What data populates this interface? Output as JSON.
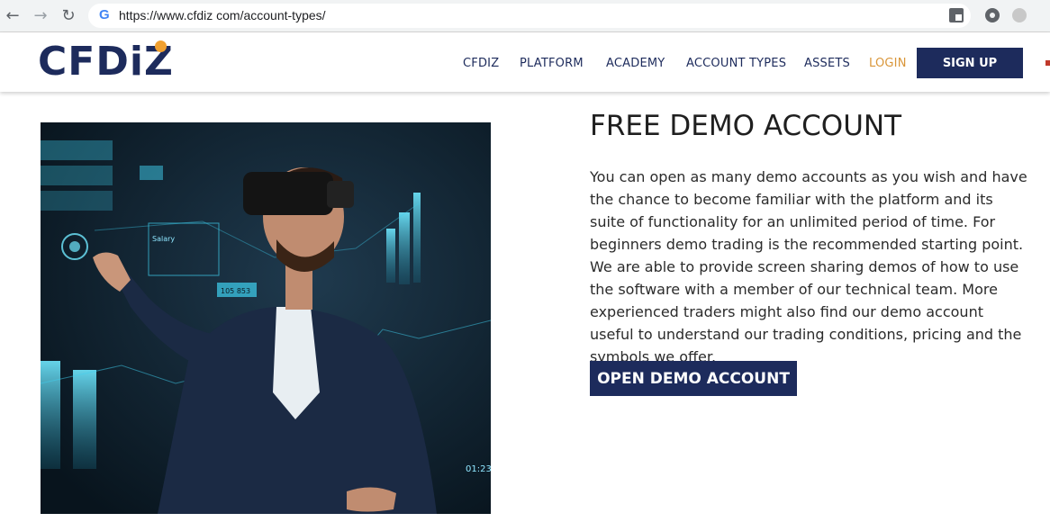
{
  "browser": {
    "url": "https://www.cfdiz com/account-types/",
    "google_mark": "G"
  },
  "header": {
    "logo": "CFDiZ",
    "nav": [
      {
        "label": "CFDIZ"
      },
      {
        "label": "PLATFORM"
      },
      {
        "label": "ACADEMY"
      },
      {
        "label": "ACCOUNT TYPES"
      },
      {
        "label": "ASSETS"
      },
      {
        "label": "LOGIN"
      }
    ],
    "signup_label": "SIGN UP"
  },
  "hero_image": {
    "labels": [
      "Salary",
      "105 853",
      "01:23"
    ]
  },
  "content": {
    "title": "FREE DEMO ACCOUNT",
    "description": "You can open as many demo accounts as you wish and have the chance to become familiar with the platform and its suite of functionality for an unlimited period of time. For beginners demo trading is the recommended starting point. We are able to provide screen sharing demos of how to use the software with a member of our technical team. More experienced traders might also find our demo account useful to understand our trading conditions, pricing and the symbols we offer.",
    "cta_label": "OPEN DEMO ACCOUNT"
  },
  "colors": {
    "brand_navy": "#1d2b5c",
    "login_accent": "#d9963a",
    "hero_glow": "#3fd0f0"
  }
}
